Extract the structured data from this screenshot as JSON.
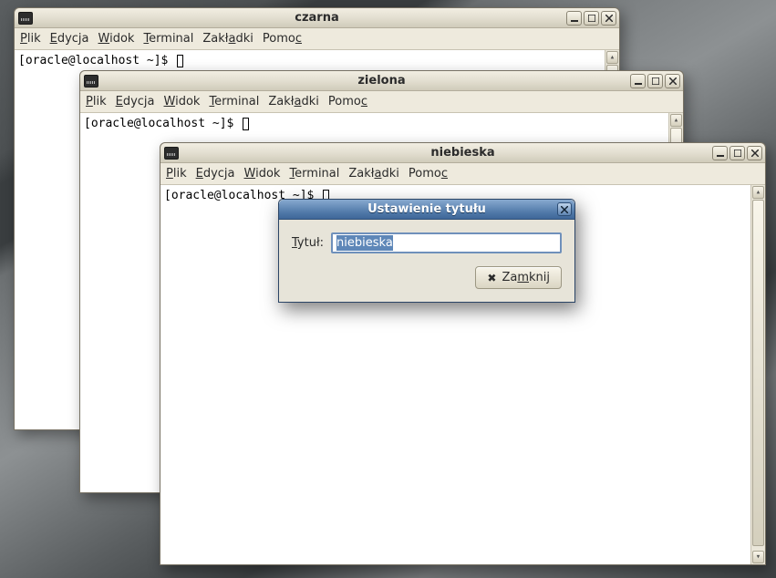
{
  "menu": {
    "plik": "Plik",
    "edycja": "Edycja",
    "widok": "Widok",
    "terminal": "Terminal",
    "zakladki": "Zakładki",
    "pomoc": "Pomoc",
    "pUnder": "P",
    "eUnder": "E",
    "wUnder": "W",
    "tUnder": "T",
    "zak1": "Zakł",
    "zakA": "a",
    "zak2": "dki",
    "pom1": "Pomo",
    "pomC": "c"
  },
  "prompt": "[oracle@localhost ~]$ ",
  "windows": {
    "w1": {
      "title": "czarna"
    },
    "w2": {
      "title": "zielona"
    },
    "w3": {
      "title": "niebieska"
    }
  },
  "dialog": {
    "title": "Ustawienie tytułu",
    "label_pre": "T",
    "label_under": "y",
    "label_post": "tuł:",
    "value": "niebieska",
    "close_pre": "Za",
    "close_under": "m",
    "close_post": "knij"
  }
}
